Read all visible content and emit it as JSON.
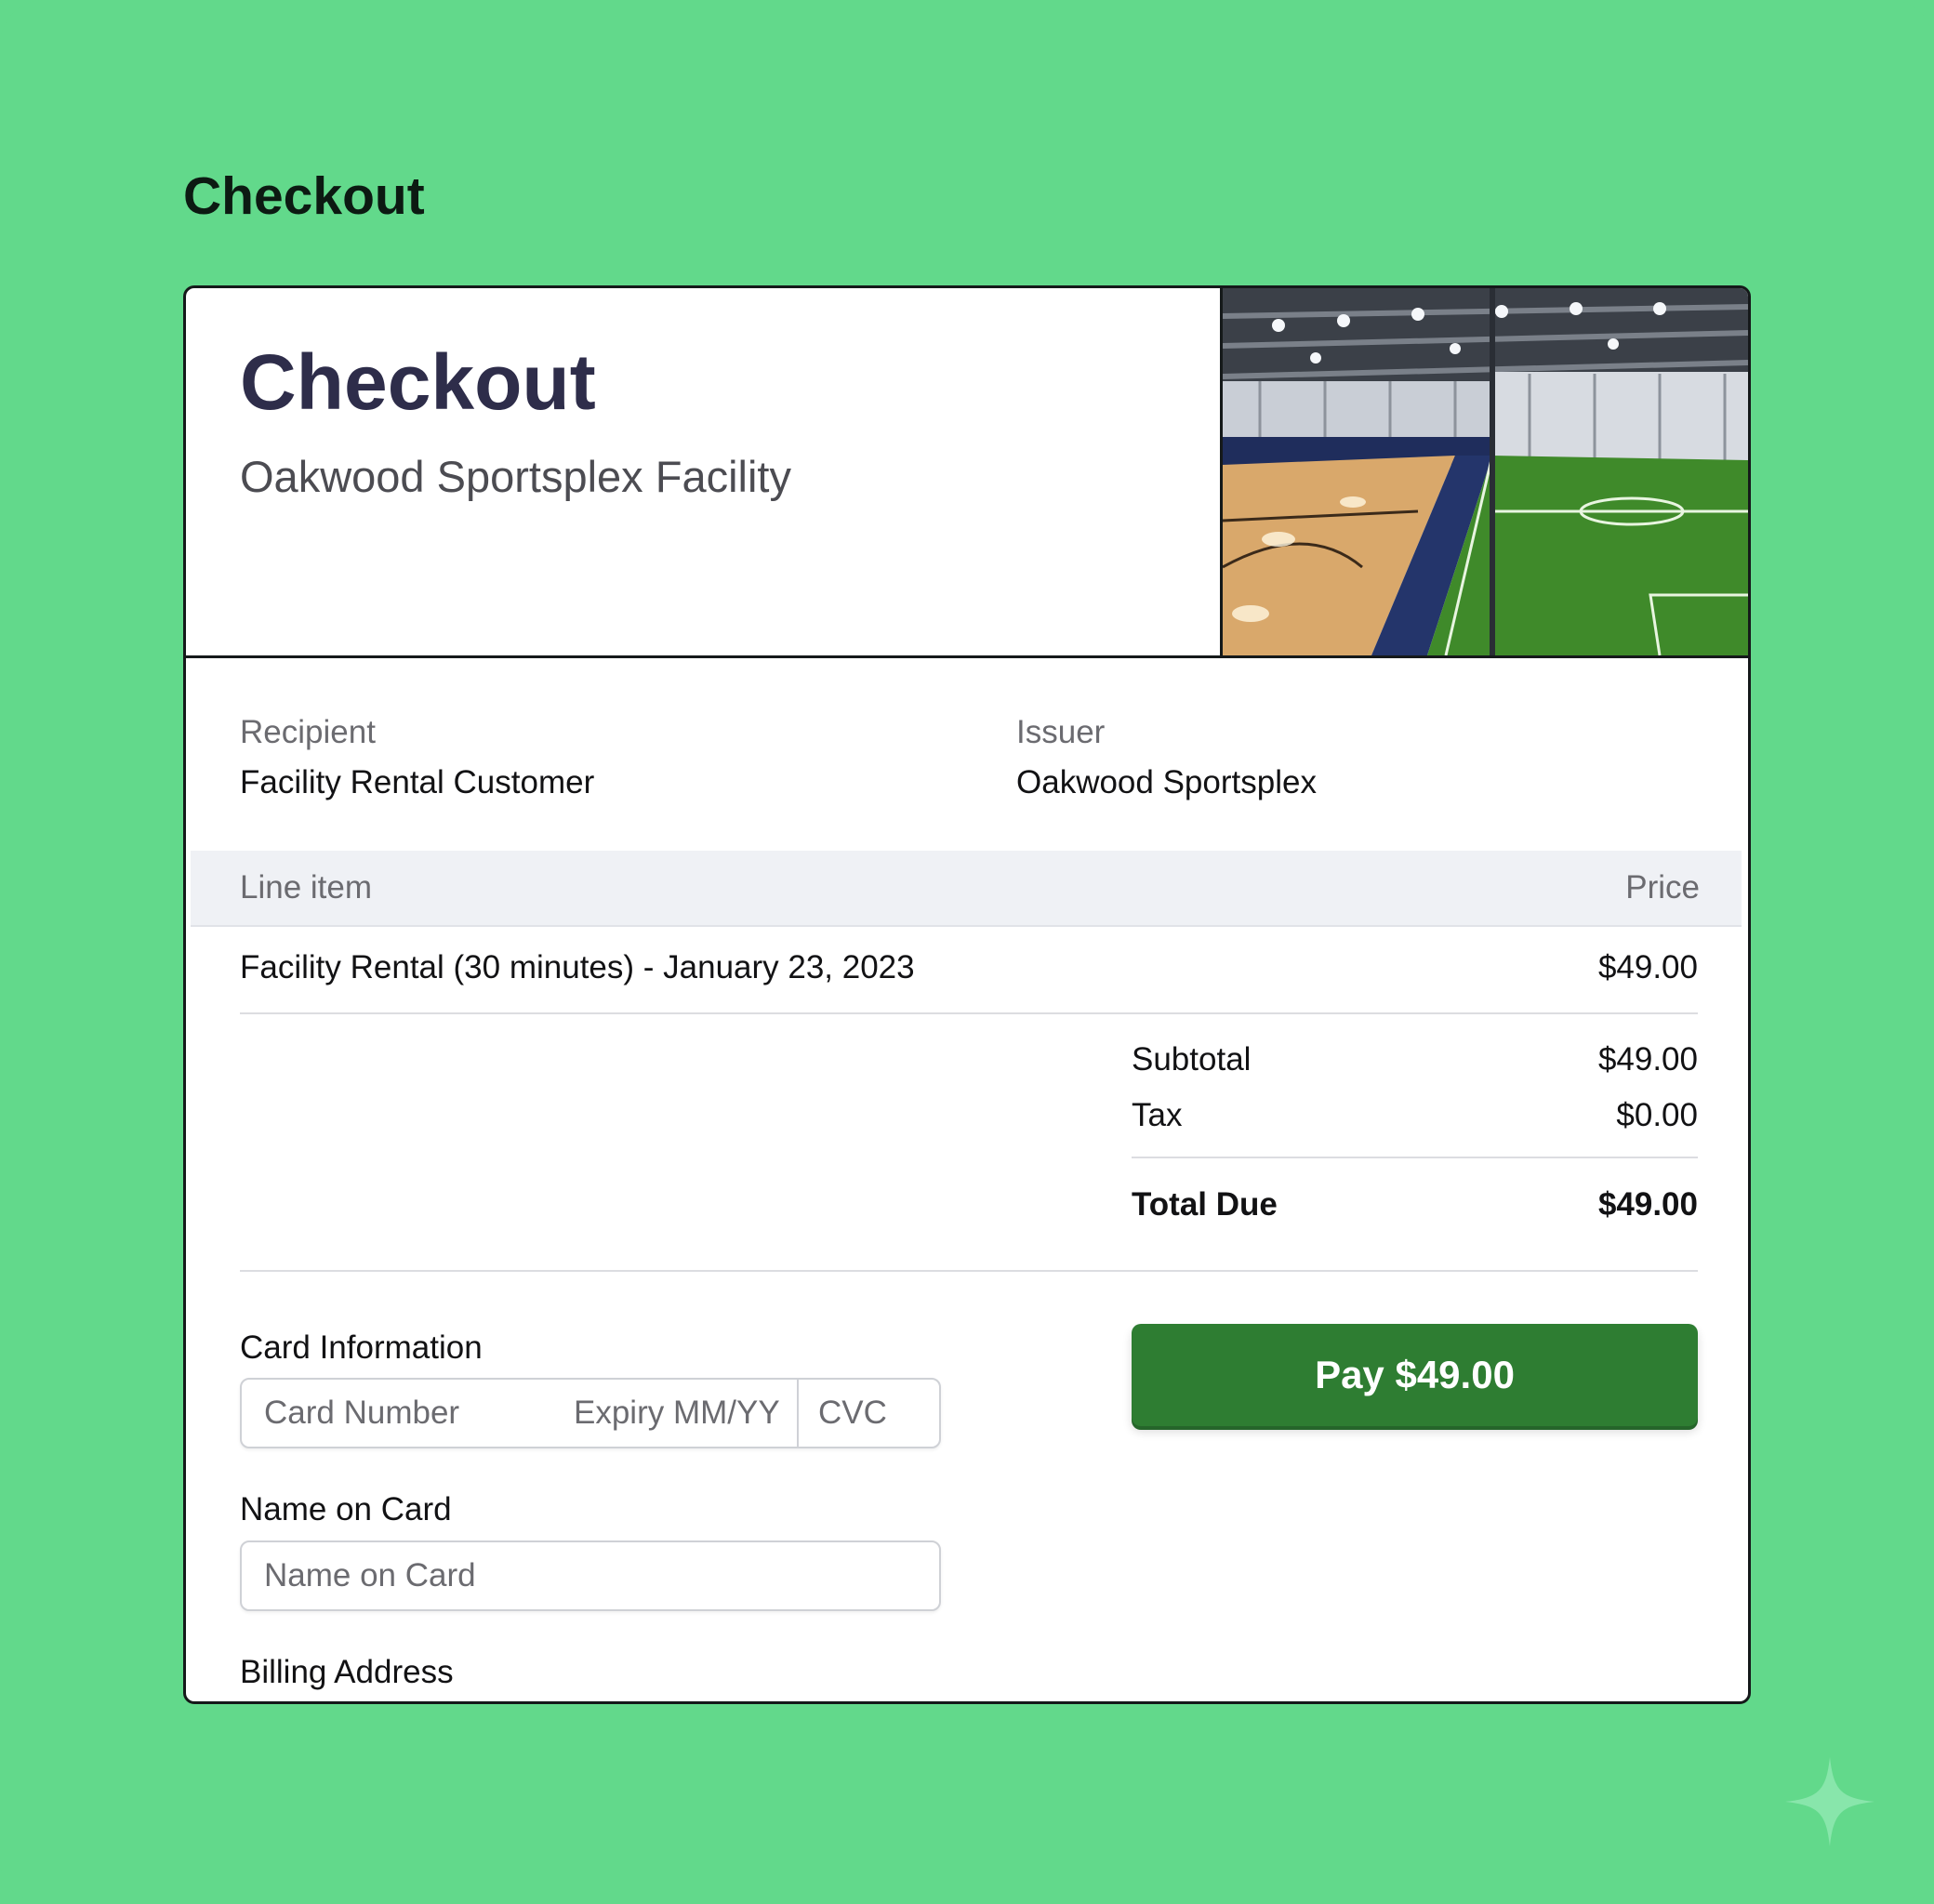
{
  "page": {
    "heading": "Checkout"
  },
  "header": {
    "title": "Checkout",
    "subtitle": "Oakwood Sportsplex Facility",
    "image_icon": "indoor-sports-facility-photo"
  },
  "parties": {
    "recipient_label": "Recipient",
    "recipient_value": "Facility Rental Customer",
    "issuer_label": "Issuer",
    "issuer_value": "Oakwood Sportsplex"
  },
  "table": {
    "columns": [
      "Line item",
      "Price"
    ],
    "rows": [
      {
        "description": "Facility Rental (30 minutes) - January 23, 2023",
        "price": "$49.00"
      }
    ]
  },
  "totals": {
    "subtotal_label": "Subtotal",
    "subtotal_value": "$49.00",
    "tax_label": "Tax",
    "tax_value": "$0.00",
    "total_label": "Total Due",
    "total_value": "$49.00"
  },
  "payment": {
    "card_info_label": "Card Information",
    "card_number_placeholder": "Card Number",
    "expiry_placeholder": "Expiry MM/YY",
    "cvc_placeholder": "CVC",
    "name_label": "Name on Card",
    "name_placeholder": "Name on Card",
    "billing_label": "Billing Address",
    "pay_button_label": "Pay $49.00"
  },
  "colors": {
    "background": "#62d98b",
    "pay_button": "#2e7d32",
    "title": "#2e2d4a"
  },
  "decor": {
    "corner_icon": "sparkle-icon"
  }
}
